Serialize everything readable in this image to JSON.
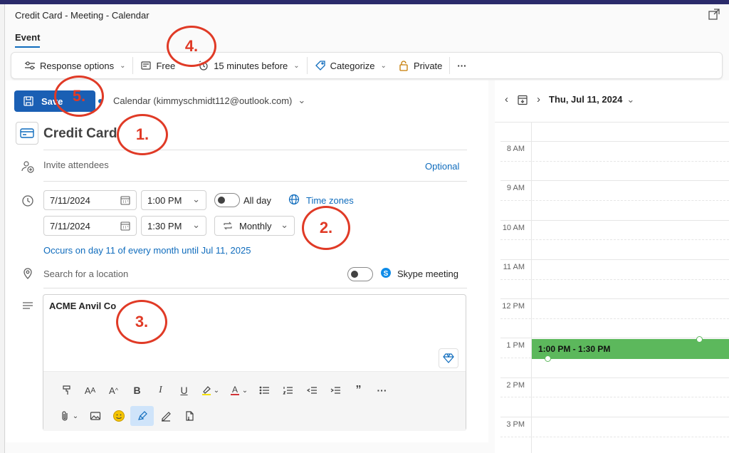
{
  "window": {
    "title": "Credit Card - Meeting - Calendar"
  },
  "tabs": {
    "event": "Event"
  },
  "toolbar": {
    "response_options": "Response options",
    "free": "Free",
    "reminder": "15 minutes before",
    "categorize": "Categorize",
    "private": "Private",
    "more": "···"
  },
  "form": {
    "save": "Save",
    "calendar": "Calendar (kimmyschmidt112@outlook.com)",
    "title": "Credit Card",
    "invite_placeholder": "Invite attendees",
    "optional": "Optional",
    "start_date": "7/11/2024",
    "start_time": "1:00 PM",
    "all_day": "All day",
    "time_zones": "Time zones",
    "end_date": "7/11/2024",
    "end_time": "1:30 PM",
    "recurrence": "Monthly",
    "recurrence_summary": "Occurs on day 11 of every month until Jul 11, 2025",
    "location_placeholder": "Search for a location",
    "skype": "Skype meeting",
    "body": "ACME Anvil Co"
  },
  "format": {
    "row1": [
      "format-painter-icon",
      "font-size-icon",
      "font-grow-icon",
      "bold-icon",
      "italic-icon",
      "underline-icon",
      "highlight-icon",
      "font-color-icon",
      "bullets-icon",
      "numbering-icon",
      "outdent-icon",
      "indent-icon",
      "quote-icon",
      "more-icon"
    ],
    "row2": [
      "attach-icon",
      "image-icon",
      "emoji-icon",
      "editor-icon",
      "signature-icon",
      "dictate-icon"
    ]
  },
  "calendar": {
    "date": "Thu, Jul 11, 2024",
    "hours": [
      "8 AM",
      "9 AM",
      "10 AM",
      "11 AM",
      "12 PM",
      "1 PM",
      "2 PM",
      "3 PM"
    ],
    "event": "1:00 PM - 1:30 PM",
    "event_color": "#5cb85c"
  },
  "annotations": [
    "1.",
    "2.",
    "3.",
    "4.",
    "5."
  ],
  "colors": {
    "accent": "#0f6cbd",
    "save": "#1a5fb4",
    "annotation": "#e03a26"
  }
}
